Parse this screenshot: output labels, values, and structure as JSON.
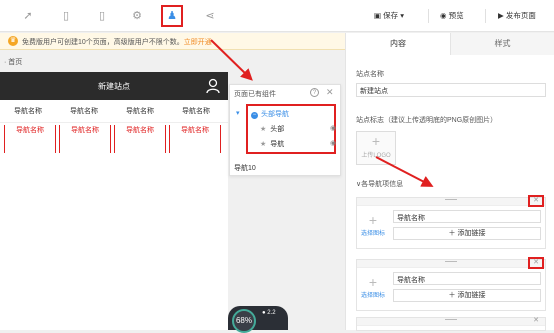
{
  "toolbar": {
    "save_label": "保存",
    "preview_label": "预览",
    "publish_label": "发布页面"
  },
  "notice": {
    "text": "免费版用户可创建10个页面，高级版用户不限个数。",
    "link": "立即开通"
  },
  "breadcrumb": "首页",
  "preview": {
    "site_title": "新建站点",
    "nav_top": [
      "导航名称",
      "导航名称",
      "导航名称",
      "导航名称"
    ],
    "nav_bottom": [
      "导航名称",
      "导航名称",
      "导航名称",
      "导航名称"
    ]
  },
  "components_panel": {
    "title": "页面已有组件",
    "root": "头部导航",
    "items": [
      "头部",
      "导航"
    ],
    "footer_item": "导航10"
  },
  "right_panel": {
    "tabs": [
      "内容",
      "样式"
    ],
    "site_name_label": "站点名称",
    "site_name_value": "新建站点",
    "logo_label": "站点标志（建议上传透明底的PNG原创图片）",
    "upload_text": "上传LOGO",
    "nav_section_label": "各导航项信息",
    "cards": [
      {
        "name": "导航名称",
        "link_label": "＋ 添加链接",
        "pick_icon": "选择图标"
      },
      {
        "name": "导航名称",
        "link_label": "＋ 添加链接",
        "pick_icon": "选择图标"
      }
    ]
  },
  "speed": {
    "percent": "68",
    "unit": "%",
    "rate": "2.2"
  },
  "colors": {
    "accent": "#3a8ee6",
    "highlight": "#e02020",
    "header": "#2b2b2b"
  }
}
